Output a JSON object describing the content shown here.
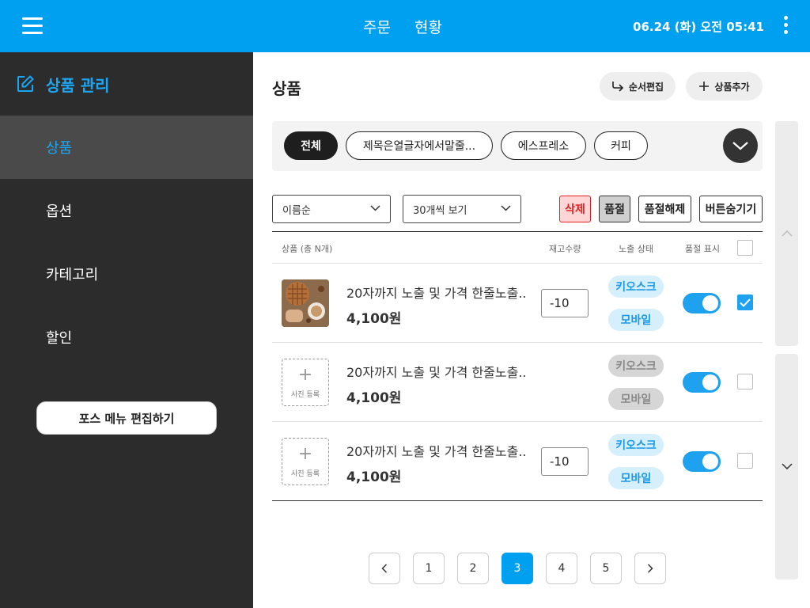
{
  "topbar": {
    "menu_icon": "hamburger-icon",
    "tabs": [
      "주문",
      "현황"
    ],
    "datetime": "06.24 (화) 오전 05:41",
    "more_icon": "kebab-icon"
  },
  "sidebar": {
    "header_icon": "edit-icon",
    "header": "상품 관리",
    "items": [
      "상품",
      "옵션",
      "카테고리",
      "할인"
    ],
    "active_index": 0,
    "pos_button": "포스 메뉴 편집하기"
  },
  "main": {
    "title": "상품",
    "reorder_button": "순서편집",
    "add_button": "상품추가",
    "categories": [
      "전체",
      "제목은열글자에서말줄...",
      "에스프레소",
      "커피"
    ],
    "sort_select": "이름순",
    "per_page_select": "30개씩 보기",
    "actions": {
      "delete": "삭제",
      "soldout": "품절",
      "unsoldout": "품절해제",
      "hide_buttons": "버튼숨기기"
    },
    "table_headers": {
      "product": "상품 (총 N개)",
      "stock": "재고수량",
      "exposure": "노출 상태",
      "soldout": "품절 표시"
    },
    "rows": [
      {
        "name": "20자까지 노출 및 가격 한줄노출..",
        "price": "4,100원",
        "stock": "-10",
        "tag_kiosk": "키오스크",
        "tag_mobile": "모바일",
        "photo_caption": ""
      },
      {
        "name": "20자까지 노출 및 가격 한줄노출..",
        "price": "4,100원",
        "stock": "",
        "tag_kiosk": "키오스크",
        "tag_mobile": "모바일",
        "photo_caption": "사진 등록"
      },
      {
        "name": "20자까지 노출 및 가격 한줄노출..",
        "price": "4,100원",
        "stock": "-10",
        "tag_kiosk": "키오스크",
        "tag_mobile": "모바일",
        "photo_caption": "사진 등록"
      }
    ],
    "pagination": [
      "1",
      "2",
      "3",
      "4",
      "5"
    ],
    "current_page": "3"
  },
  "colors": {
    "brand": "#00a0f0",
    "sidebar_bg": "#2c2c2c",
    "accent_text": "#1aa7f5",
    "danger": "#e02020"
  }
}
